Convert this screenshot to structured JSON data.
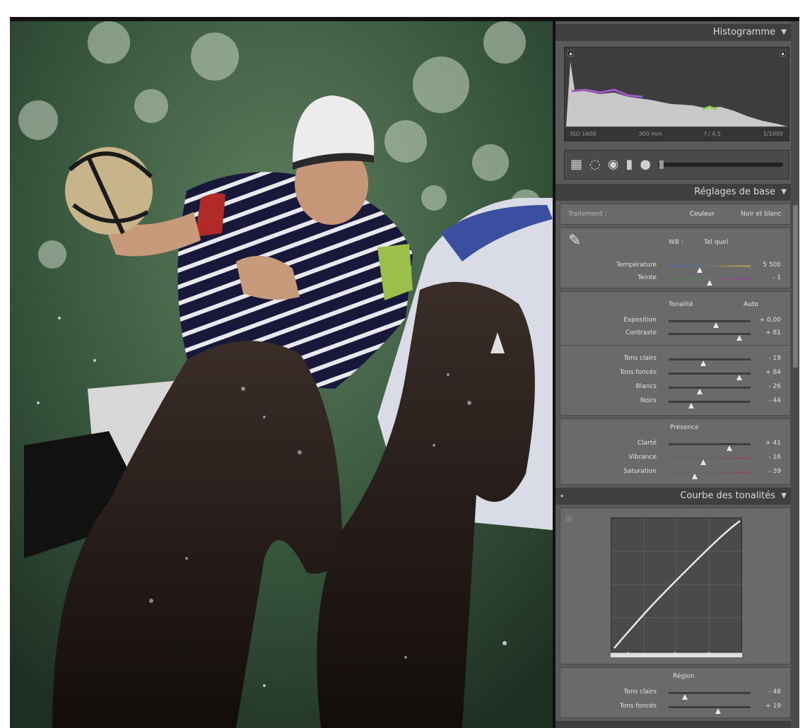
{
  "histogram": {
    "title": "Histogramme",
    "info": [
      "ISO 1600",
      "300 mm",
      "f / 4,5",
      "1/1000"
    ]
  },
  "basic": {
    "title": "Réglages de base",
    "treatment_label": "Traitement :",
    "treatment_color": "Couleur",
    "treatment_bw": "Noir et blanc",
    "wb_label": "WB :",
    "wb_value": "Tel quel",
    "tone_label": "Tonalité",
    "auto_label": "Auto",
    "presence_label": "Présence",
    "sliders": [
      {
        "label": "Température",
        "value": "5 500",
        "pos": 0.38
      },
      {
        "label": "Teinte",
        "value": "- 1",
        "pos": 0.5
      },
      {
        "label": "Exposition",
        "value": "+ 0,00",
        "pos": 0.58
      },
      {
        "label": "Contraste",
        "value": "+ 81",
        "pos": 0.86
      },
      {
        "label": "Tons clairs",
        "value": "- 19",
        "pos": 0.42
      },
      {
        "label": "Tons foncés",
        "value": "+ 84",
        "pos": 0.86
      },
      {
        "label": "Blancs",
        "value": "- 26",
        "pos": 0.38
      },
      {
        "label": "Noirs",
        "value": "- 44",
        "pos": 0.28
      },
      {
        "label": "Clarté",
        "value": "+ 41",
        "pos": 0.74
      },
      {
        "label": "Vibrance",
        "value": "- 16",
        "pos": 0.42
      },
      {
        "label": "Saturation",
        "value": "- 39",
        "pos": 0.32
      }
    ]
  },
  "tone_curve": {
    "title": "Courbe des tonalités",
    "region_label": "Région",
    "sliders": [
      {
        "label": "Tons clairs",
        "value": "- 48",
        "pos": 0.2
      },
      {
        "label": "Tons foncés",
        "value": "+ 19",
        "pos": 0.6
      }
    ]
  },
  "colors": {
    "panel": "#5a5a5a",
    "header": "#3f3f3f",
    "accent_green": "#8fd14f",
    "accent_purple": "#a259c8"
  }
}
